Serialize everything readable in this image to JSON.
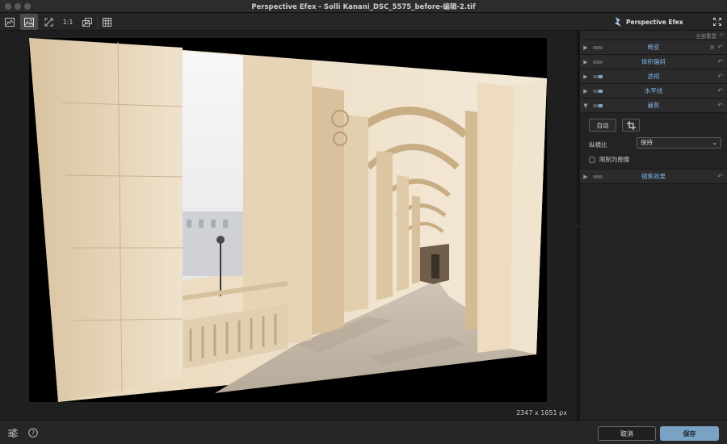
{
  "window": {
    "title": "Perspective Efex - Solli Kanani_DSC_5575_before-编辑-2.tif"
  },
  "toolbar": {
    "buttons": [
      {
        "name": "histogram-icon"
      },
      {
        "name": "image-view-icon",
        "active": true
      },
      {
        "name": "fit-screen-icon"
      },
      {
        "name": "actual-size-label",
        "label": "1:1"
      },
      {
        "name": "compare-icon"
      },
      {
        "name": "grid-icon"
      }
    ],
    "brand": "Perspective Efex",
    "fullscreen_icon": "expand-icon"
  },
  "canvas": {
    "dimensions": "2347 x 1651 px"
  },
  "panel": {
    "reset_all": "全部重置",
    "sections": [
      {
        "label": "畸变",
        "toggle_on": false
      },
      {
        "label": "体积偏斜",
        "toggle_on": false
      },
      {
        "label": "透视",
        "toggle_on": true
      },
      {
        "label": "水平线",
        "toggle_on": true
      },
      {
        "label": "裁剪",
        "toggle_on": true,
        "expanded": true
      },
      {
        "label": "镜焦效果",
        "toggle_on": false
      }
    ],
    "crop": {
      "auto_label": "自动",
      "ratio_label": "纵横比",
      "ratio_value": "保持",
      "constrain_label": "限制为图像",
      "constrain_checked": false
    }
  },
  "bottom": {
    "cancel_label": "取消",
    "save_label": "保存",
    "accent_color": "#7aa2c4"
  }
}
